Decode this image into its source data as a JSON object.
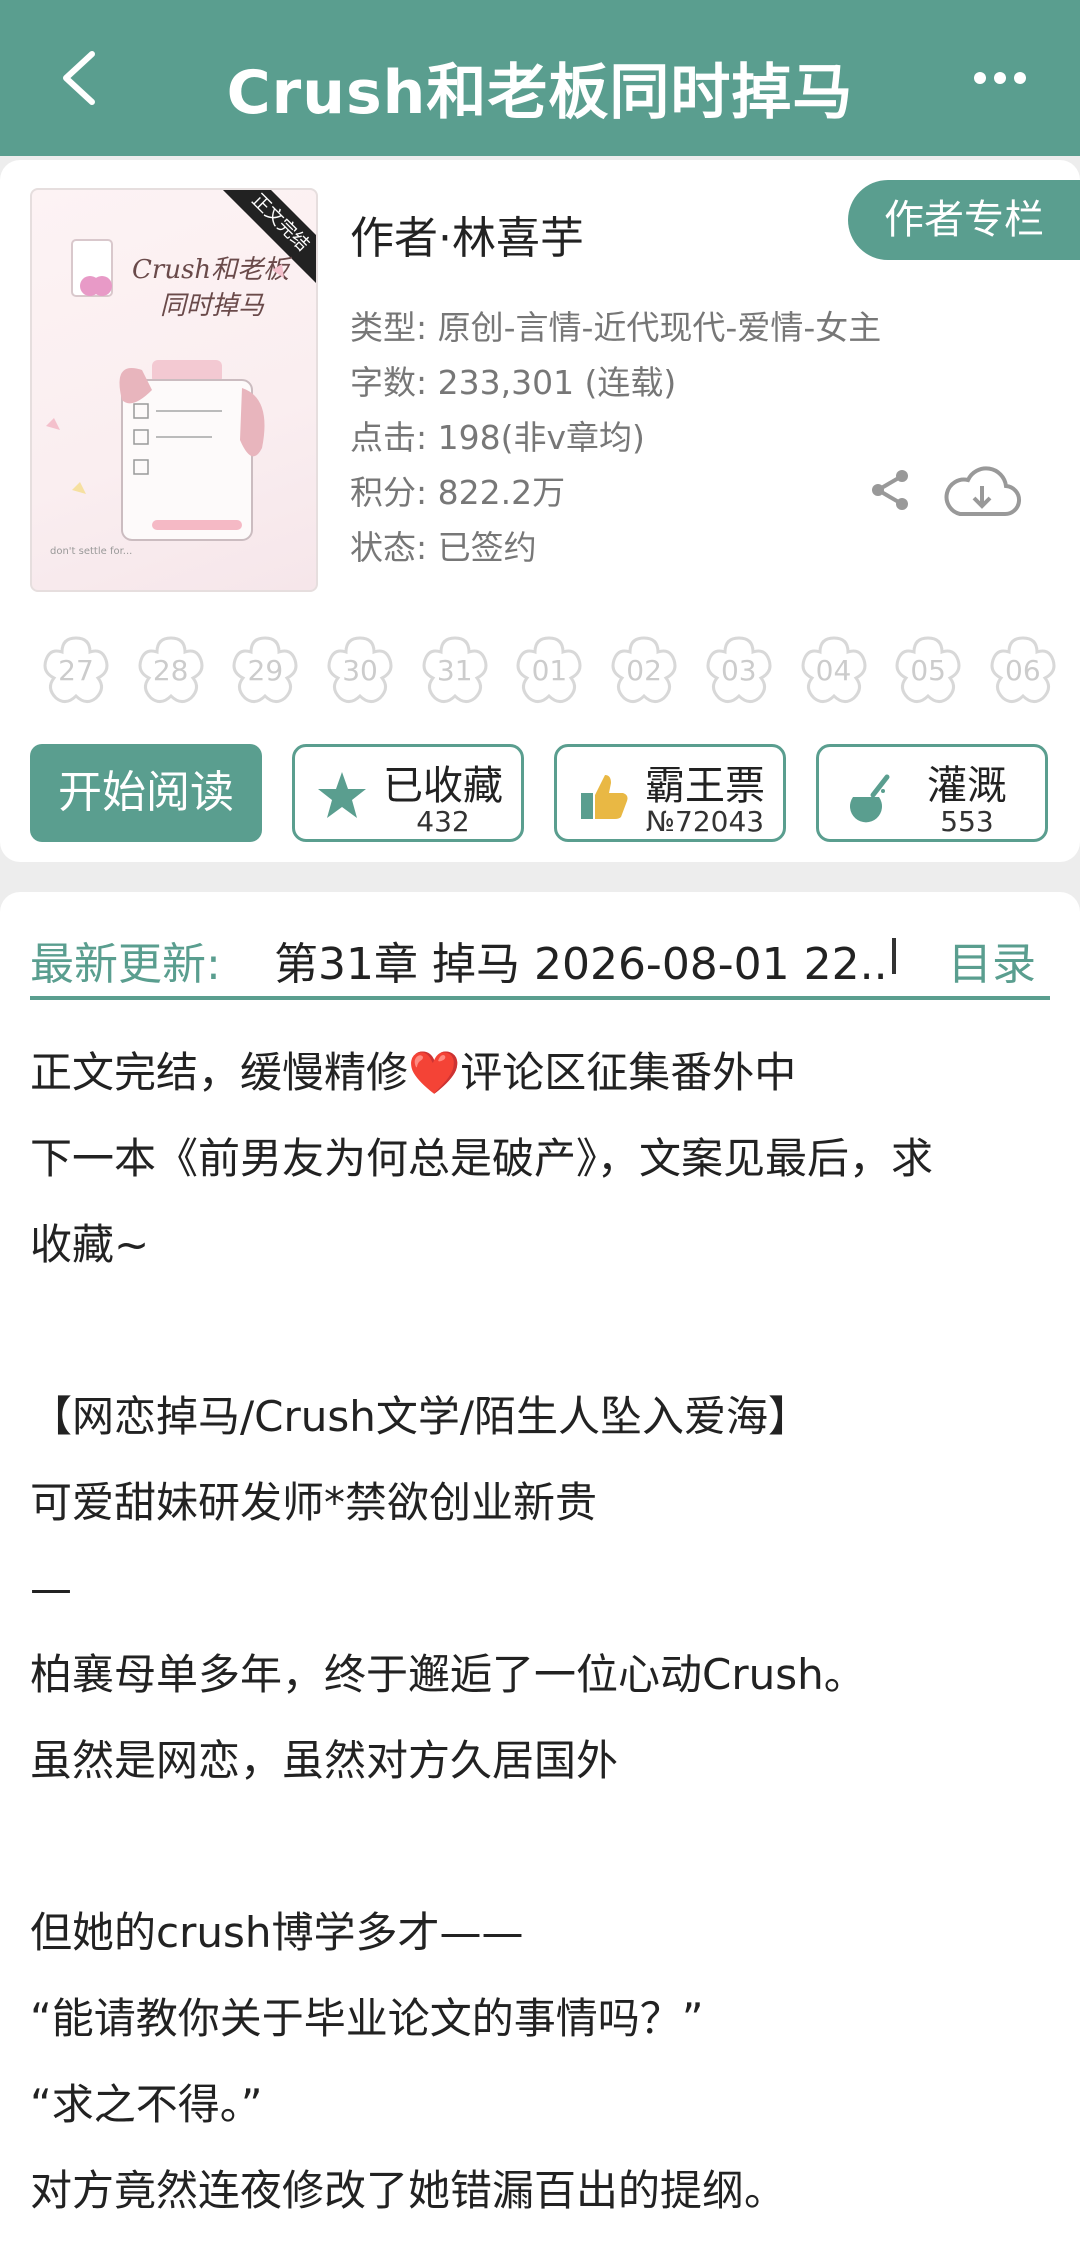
{
  "header": {
    "title": "Crush和老板同时掉马"
  },
  "book": {
    "cover_corner": "正文完结",
    "cover_title_line1": "Crush和老板",
    "cover_title_line2": "同时掉马",
    "author": "作者·林喜芋",
    "column_button": "作者专栏",
    "meta": [
      "类型: 原创-言情-近代现代-爱情-女主",
      "字数: 233,301 (连载)",
      "点击: 198(非v章均)",
      "积分: 822.2万",
      "状态: 已签约"
    ]
  },
  "calendar_days": [
    "27",
    "28",
    "29",
    "30",
    "31",
    "01",
    "02",
    "03",
    "04",
    "05",
    "06"
  ],
  "actions": {
    "start_reading": "开始阅读",
    "favorite": {
      "label": "已收藏",
      "count": "432"
    },
    "bawang": {
      "label": "霸王票",
      "count": "№72043"
    },
    "irrigate": {
      "label": "灌溉",
      "count": "553"
    }
  },
  "latest": {
    "label": "最新更新:",
    "text": "第31章  掉马  2026-08-01 22..",
    "toc": "目录"
  },
  "intro_lines": [
    "正文完结，缓慢精修❤️评论区征集番外中",
    "下一本《前男友为何总是破产》，文案见最后，求",
    "收藏~",
    "",
    "【网恋掉马/Crush文学/陌生人坠入爱海】",
    "可爱甜妹研发师*禁欲创业新贵",
    "—",
    "柏襄母单多年，终于邂逅了一位心动Crush。",
    "虽然是网恋，虽然对方久居国外",
    "",
    "但她的crush博学多才——",
    "“能请教你关于毕业论文的事情吗？”",
    "“求之不得。”",
    "对方竟然连夜修改了她错漏百出的提纲。"
  ],
  "colors": {
    "accent": "#5a9e8f"
  }
}
